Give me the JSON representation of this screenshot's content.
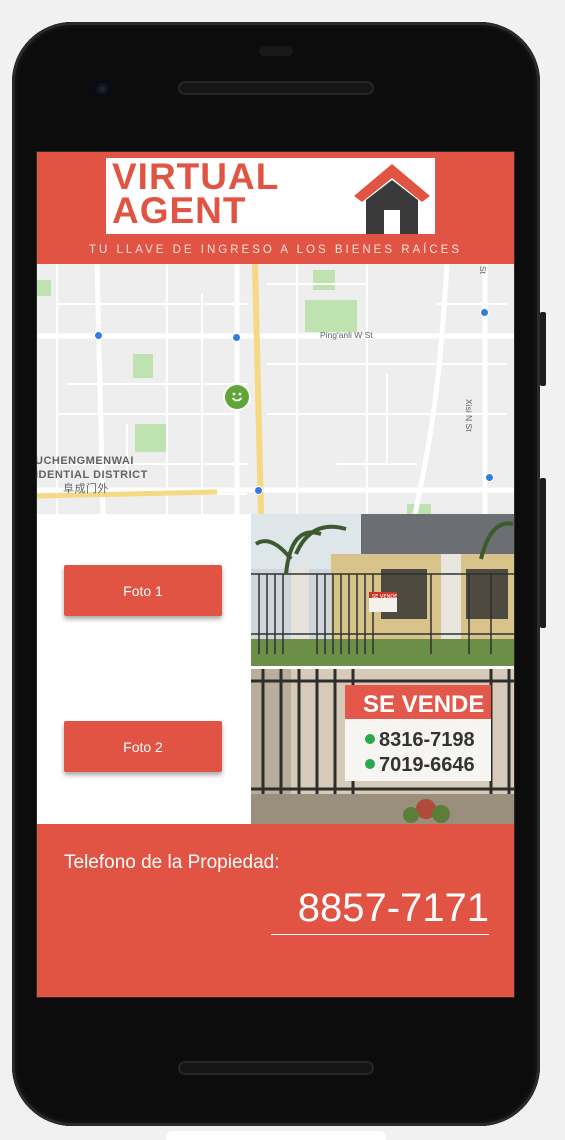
{
  "header": {
    "logo_line1": "VIRTUAL",
    "logo_line2": "AGENT",
    "tagline": "TU LLAVE DE INGRESO A LOS BIENES RAÍCES"
  },
  "map": {
    "street_ping": "Ping'anli W St",
    "street_xisi": "Xisi N St",
    "district_line1": "UCHENGMENWAI",
    "district_line2": "IDENTIAL DISTRICT",
    "district_cn": "阜成门外",
    "st_corner": "St"
  },
  "buttons": {
    "foto1": "Foto 1",
    "foto2": "Foto 2"
  },
  "photo2_sign": {
    "title": "SE VENDE",
    "phone1": "8316-7198",
    "phone2": "7019-6646"
  },
  "photo1_sign": "SE VENDE",
  "footer": {
    "label": "Telefono de la Propiedad:",
    "number": "8857-7171"
  },
  "colors": {
    "accent": "#e15443"
  }
}
